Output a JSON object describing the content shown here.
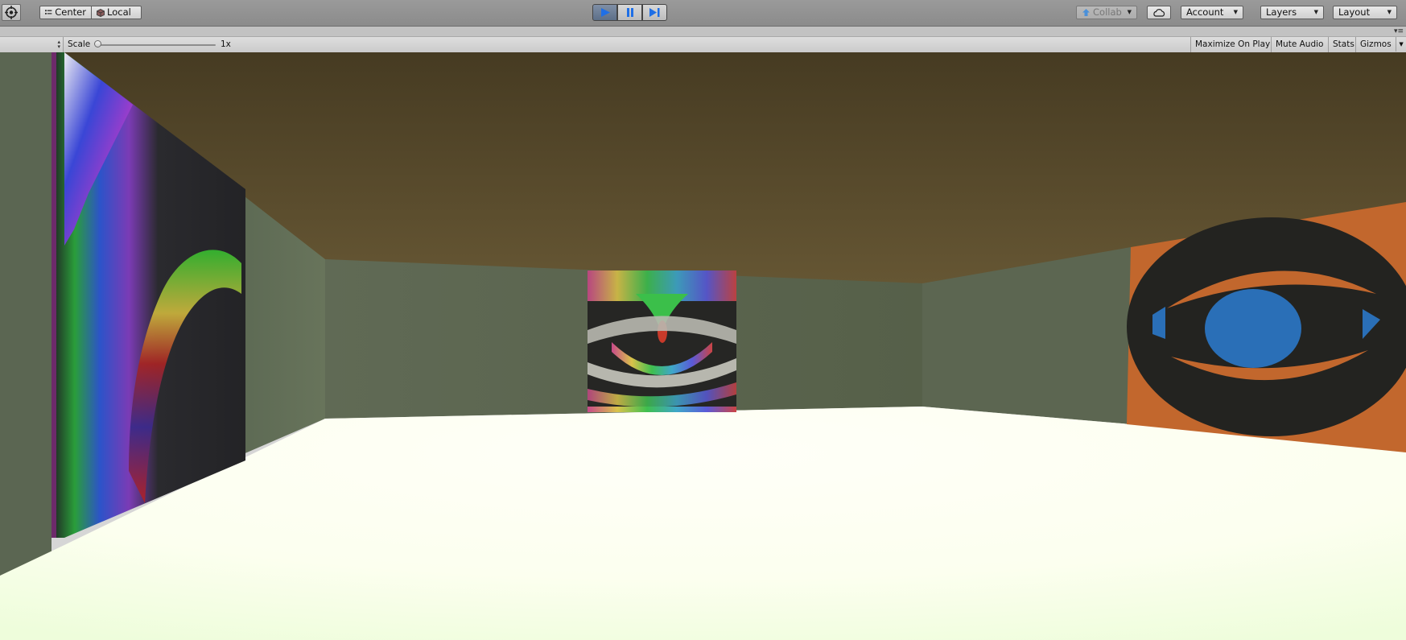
{
  "toolbar": {
    "pivot_label": "Center",
    "handle_label": "Local",
    "collab_label": "Collab",
    "account_label": "Account",
    "layers_label": "Layers",
    "layout_label": "Layout",
    "play_active": true
  },
  "game_view": {
    "scale_label": "Scale",
    "scale_value": "1x",
    "toggles": {
      "maximize_on_play": "Maximize On Play",
      "mute_audio": "Mute Audio",
      "stats": "Stats",
      "gizmos": "Gizmos"
    }
  },
  "icons": [
    "unity-logo-icon",
    "pivot-center-icon",
    "local-rotation-icon",
    "play-icon",
    "pause-icon",
    "step-icon",
    "collab-icon",
    "cloud-icon",
    "chevron-down-icon",
    "panel-menu-icon"
  ],
  "colors": {
    "play_blue": "#1f6fe6",
    "ceiling": "#5a4a2c",
    "walls": "#5f6a55",
    "floor": "#fbfff0",
    "orange_panel": "#c2672d",
    "iris": "#2a6fb7"
  }
}
